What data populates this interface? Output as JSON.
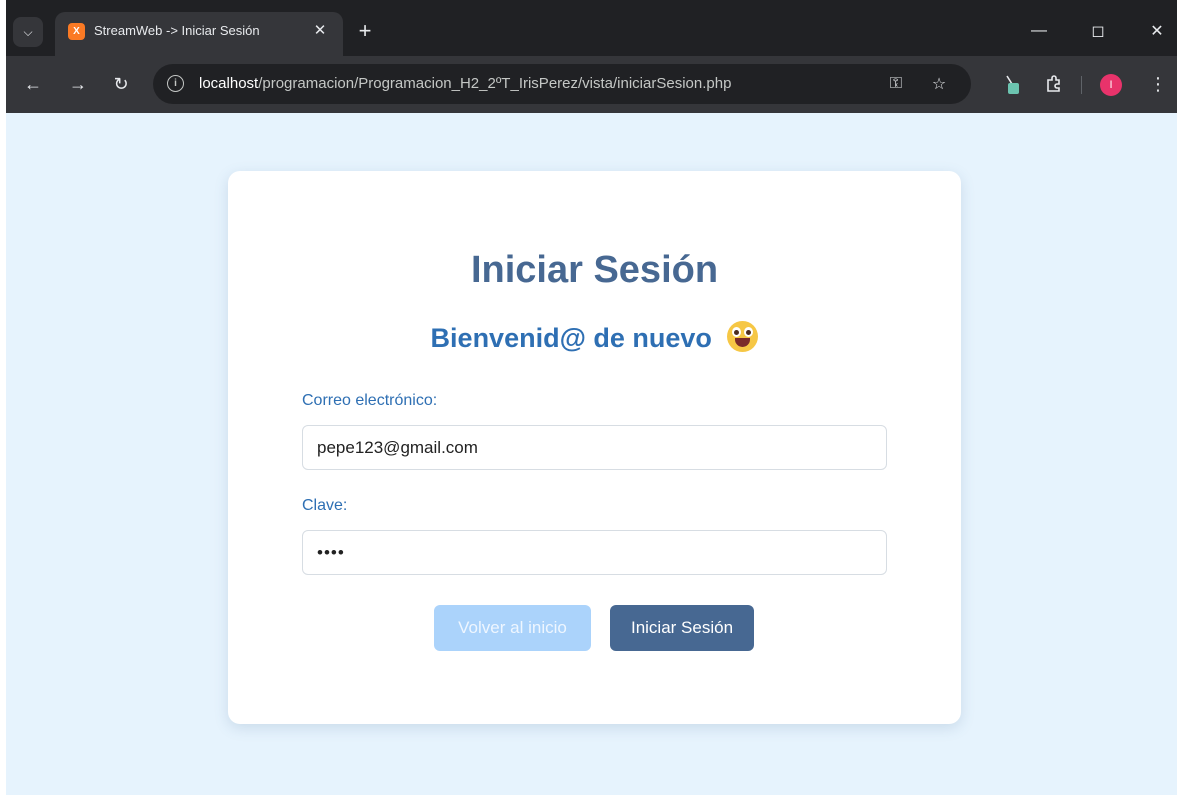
{
  "browser": {
    "tab_title": "StreamWeb -> Iniciar Sesión",
    "tab_favicon_letter": "X",
    "url_host": "localhost",
    "url_path": "/programacion/Programacion_H2_2ºT_IrisPerez/vista/iniciarSesion.php",
    "avatar_letter": "I",
    "icons": {
      "tab_search": "chevron-down-icon",
      "close_tab": "close-icon",
      "new_tab": "plus-icon",
      "back": "arrow-left-icon",
      "forward": "arrow-right-icon",
      "reload": "reload-icon",
      "site_info": "info-icon",
      "password_key": "key-icon",
      "bookmark": "star-icon",
      "extension_pin": "brush-icon",
      "extensions": "puzzle-icon",
      "menu": "kebab-menu-icon"
    }
  },
  "page": {
    "title": "Iniciar Sesión",
    "subtitle": "Bienvenid@ de nuevo",
    "subtitle_emoji": "grinning-face-emoji",
    "email": {
      "label": "Correo electrónico:",
      "value": "pepe123@gmail.com"
    },
    "password": {
      "label": "Clave:",
      "value_masked": "••••"
    },
    "buttons": {
      "back": "Volver al inicio",
      "login": "Iniciar Sesión"
    }
  },
  "colors": {
    "page_background": "#e6f3fd",
    "title": "#476892",
    "subtitle": "#2e6fb3",
    "primary_button": "#476892",
    "secondary_button": "#abd3fb"
  }
}
